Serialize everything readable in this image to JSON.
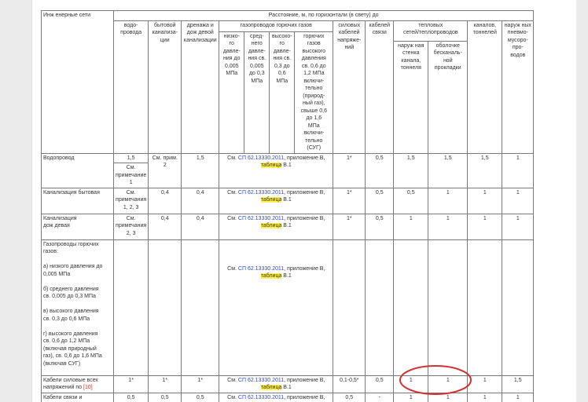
{
  "header": {
    "col_utility": "Инж енерные сети",
    "group_title": "Расстояние, м, по горизонтали (в свету) до",
    "col_water": "водо-\nпровода",
    "col_sewer_house": "бытовой\nканализа-\nции",
    "col_drainage": "дренажа и\nдож девой\nканализации",
    "gas_group": "газопроводов горючих газов",
    "gas_low": "низко-\nго\nдавле-\nния до\n0,005\nМПа",
    "gas_medium": "сред-\nнего\nдавле-\nния св.\n0,005\nдо 0,3\nМПа",
    "gas_high": "высоко-\nго\nдавле-\nния св.\n0,3 до\n0,6\nМПа",
    "gas_high2": "горючих\nгазов\nвысокого\nдавления\nсв. 0,6 до\n1,2 МПа\nвключи-\nтельно\n(природ-\nный газ),\nсвыше 0,6\nдо 1,6\nМПа\nвключи-\nтельно\n(СУГ)",
    "col_power": "силовых\nкабелей\nнапряже-\nний",
    "col_comm": "кабелей\nсвязи",
    "heat_group": "тепловых\nсетей/теплопроводов",
    "heat_outer": "наруж ная\nстенка\nканала,\nтоннеля",
    "heat_shell": "оболочке\nбесканаль-\nной\nпрокладки",
    "col_channels": "каналов,\nтоннелей",
    "col_pneumo": "наруж ных\nпневмо-\nмусоро-\nпро-\nводов"
  },
  "ref": {
    "pre": "См. ",
    "link": "СП 62.13330.2011",
    "mid": ", приложение В,",
    "hl": "таблица",
    "post": " В.1"
  },
  "rows": [
    {
      "name": "Водопровод",
      "water": "1,5",
      "water2": "См.\nпримечание\n1",
      "sewer": "См. прим.\n2",
      "drain": "1,5",
      "power": "1*",
      "comm": "0,5",
      "heat_outer": "1,5",
      "heat_shell": "1,5",
      "channels": "1,5",
      "pneumo": "1"
    },
    {
      "name": "Канализация бытовая",
      "water": "См.\nпримечания\n1, 2, 3",
      "sewer": "0,4",
      "drain": "0,4",
      "power": "1*",
      "comm": "0,5",
      "heat_outer": "0,5",
      "heat_shell": "1",
      "channels": "1",
      "pneumo": "1"
    },
    {
      "name": "Канализация\nдож девая",
      "water": "См.\nпримечания\n2, 3",
      "sewer": "0,4",
      "drain": "0,4",
      "power": "1*",
      "comm": "0,5",
      "heat_outer": "1",
      "heat_shell": "1",
      "channels": "1",
      "pneumo": "1"
    },
    {
      "name": "Газопроводы горючих\nгазов:\n\nа) низкого давления до\n0,005 МПа\n\nб) среднего давления\nсв. 0,005 до 0,3 МПа\n\nв) высокого давления\nсв. 0,3 до 0,6 МПа\n\nг) высокого давления\nсв. 0,6 до 1,2 МПа\n(включая природный\nгаз), св. 0,6 до 1,6 МПа\n(включая СУГ)"
    },
    {
      "name_pre": "Кабели силовые всех\nнапряжений по ",
      "name_ref": "[10]",
      "water": "1*",
      "sewer": "1*",
      "drain": "1*",
      "power": "0,1-0,5*",
      "comm": "0,5",
      "heat_outer": "1",
      "heat_shell": "1",
      "channels": "1",
      "pneumo": "1,5"
    },
    {
      "name": "Кабели связи и",
      "water": "0,5",
      "sewer": "0,5",
      "drain": "0,5",
      "power": "0,5",
      "comm": "-",
      "heat_outer": "1",
      "heat_shell": "1",
      "channels": "1",
      "pneumo": "1"
    }
  ],
  "annotation": {
    "shape": "circle-icon",
    "color": "#d0312d"
  }
}
